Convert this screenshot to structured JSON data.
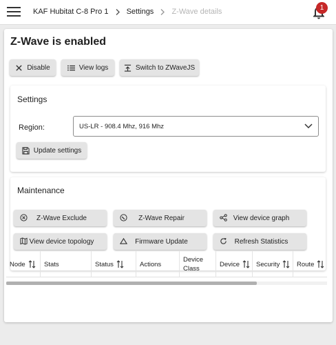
{
  "header": {
    "breadcrumbs": [
      "KAF Hubitat C-8 Pro 1",
      "Settings",
      "Z-Wave details"
    ],
    "notification_count": "1"
  },
  "page": {
    "title": "Z-Wave is enabled"
  },
  "toolbar": {
    "disable_label": "Disable",
    "view_logs_label": "View logs",
    "switch_label": "Switch to ZWaveJS"
  },
  "settings": {
    "title": "Settings",
    "region_label": "Region:",
    "region_value": "US-LR - 908.4 Mhz, 916 Mhz",
    "update_label": "Update settings"
  },
  "maintenance": {
    "title": "Maintenance",
    "buttons": [
      {
        "label": "Z-Wave Exclude",
        "icon": "cancel-circle-icon"
      },
      {
        "label": "Z-Wave Repair",
        "icon": "repair-icon"
      },
      {
        "label": "View device graph",
        "icon": "share-graph-icon"
      },
      {
        "label": "View device topology",
        "icon": "map-icon"
      },
      {
        "label": "Firmware Update",
        "icon": "triangle-up-icon"
      },
      {
        "label": "Refresh Statistics",
        "icon": "refresh-icon"
      }
    ]
  },
  "table": {
    "columns": [
      "Node",
      "Stats",
      "Status",
      "Actions",
      "Device\nClass",
      "Device",
      "Security",
      "Route"
    ]
  },
  "colors": {
    "accent_badge": "#c62828",
    "button_bg": "#e4e4e4",
    "page_bg": "#ececec"
  }
}
